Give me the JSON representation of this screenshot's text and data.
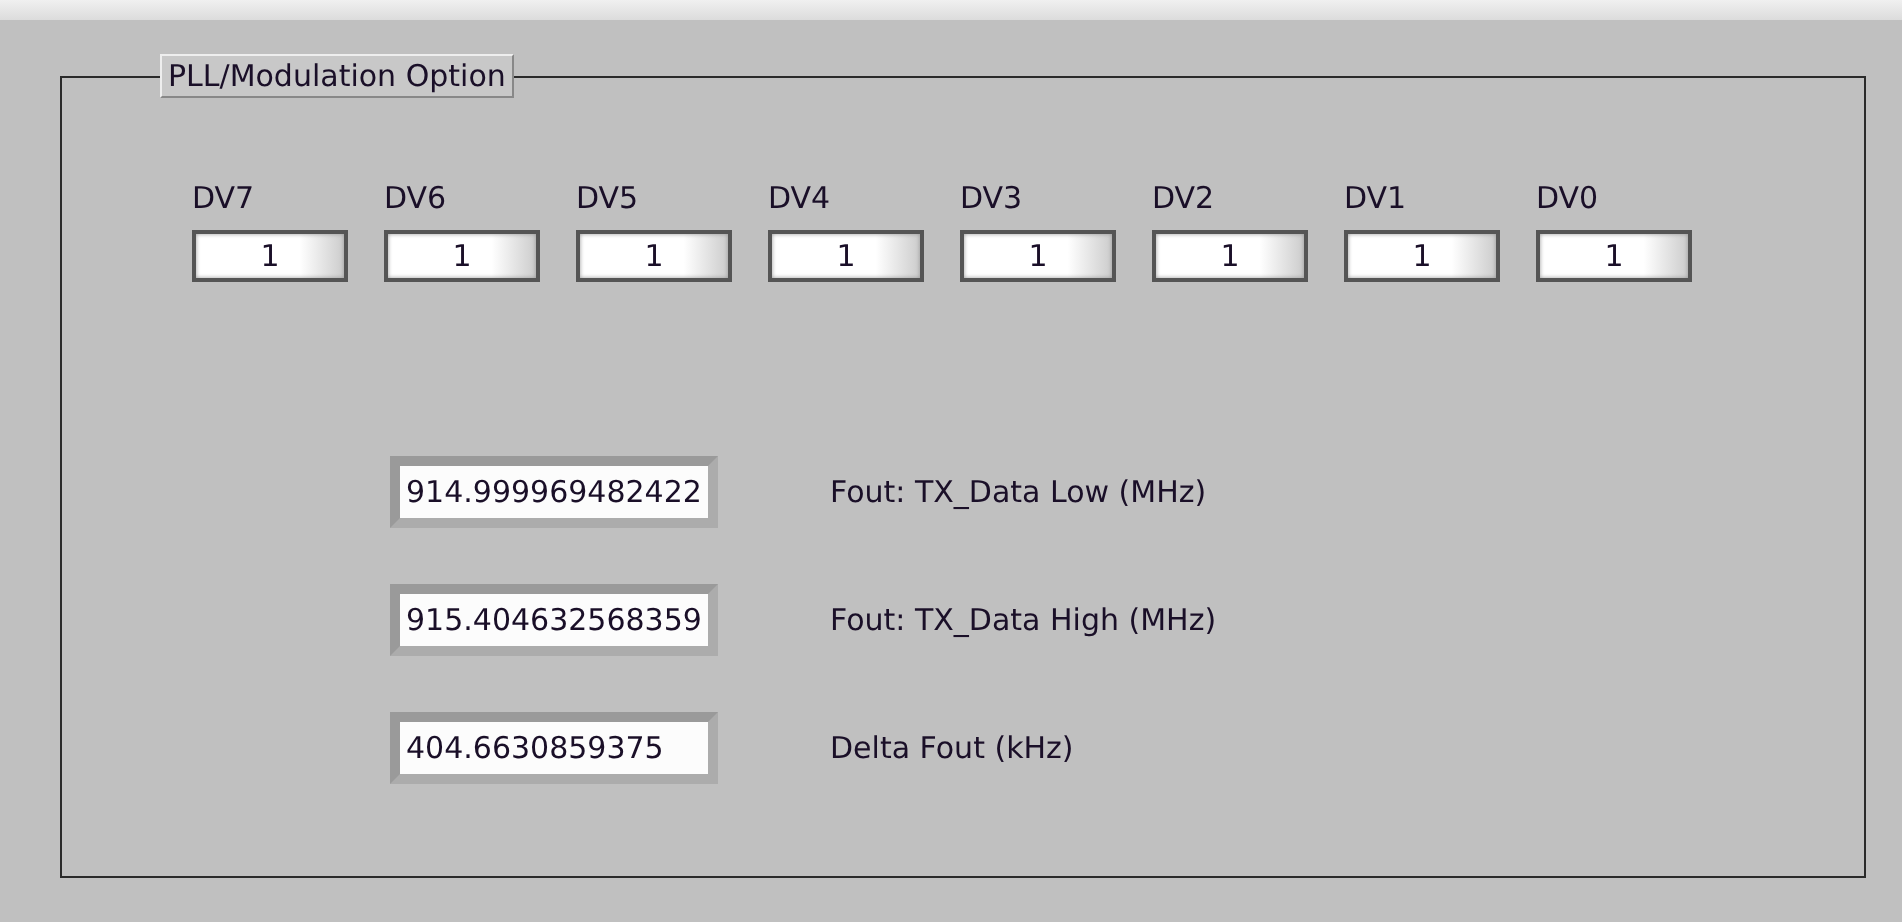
{
  "group": {
    "title": "PLL/Modulation Option"
  },
  "bits": [
    {
      "label": "DV7",
      "value": "1"
    },
    {
      "label": "DV6",
      "value": "1"
    },
    {
      "label": "DV5",
      "value": "1"
    },
    {
      "label": "DV4",
      "value": "1"
    },
    {
      "label": "DV3",
      "value": "1"
    },
    {
      "label": "DV2",
      "value": "1"
    },
    {
      "label": "DV1",
      "value": "1"
    },
    {
      "label": "DV0",
      "value": "1"
    }
  ],
  "outputs": [
    {
      "value": "914.999969482422",
      "label": "Fout: TX_Data Low (MHz)"
    },
    {
      "value": "915.404632568359",
      "label": "Fout: TX_Data High (MHz)"
    },
    {
      "value": "404.6630859375",
      "label": "Delta Fout (kHz)"
    }
  ]
}
